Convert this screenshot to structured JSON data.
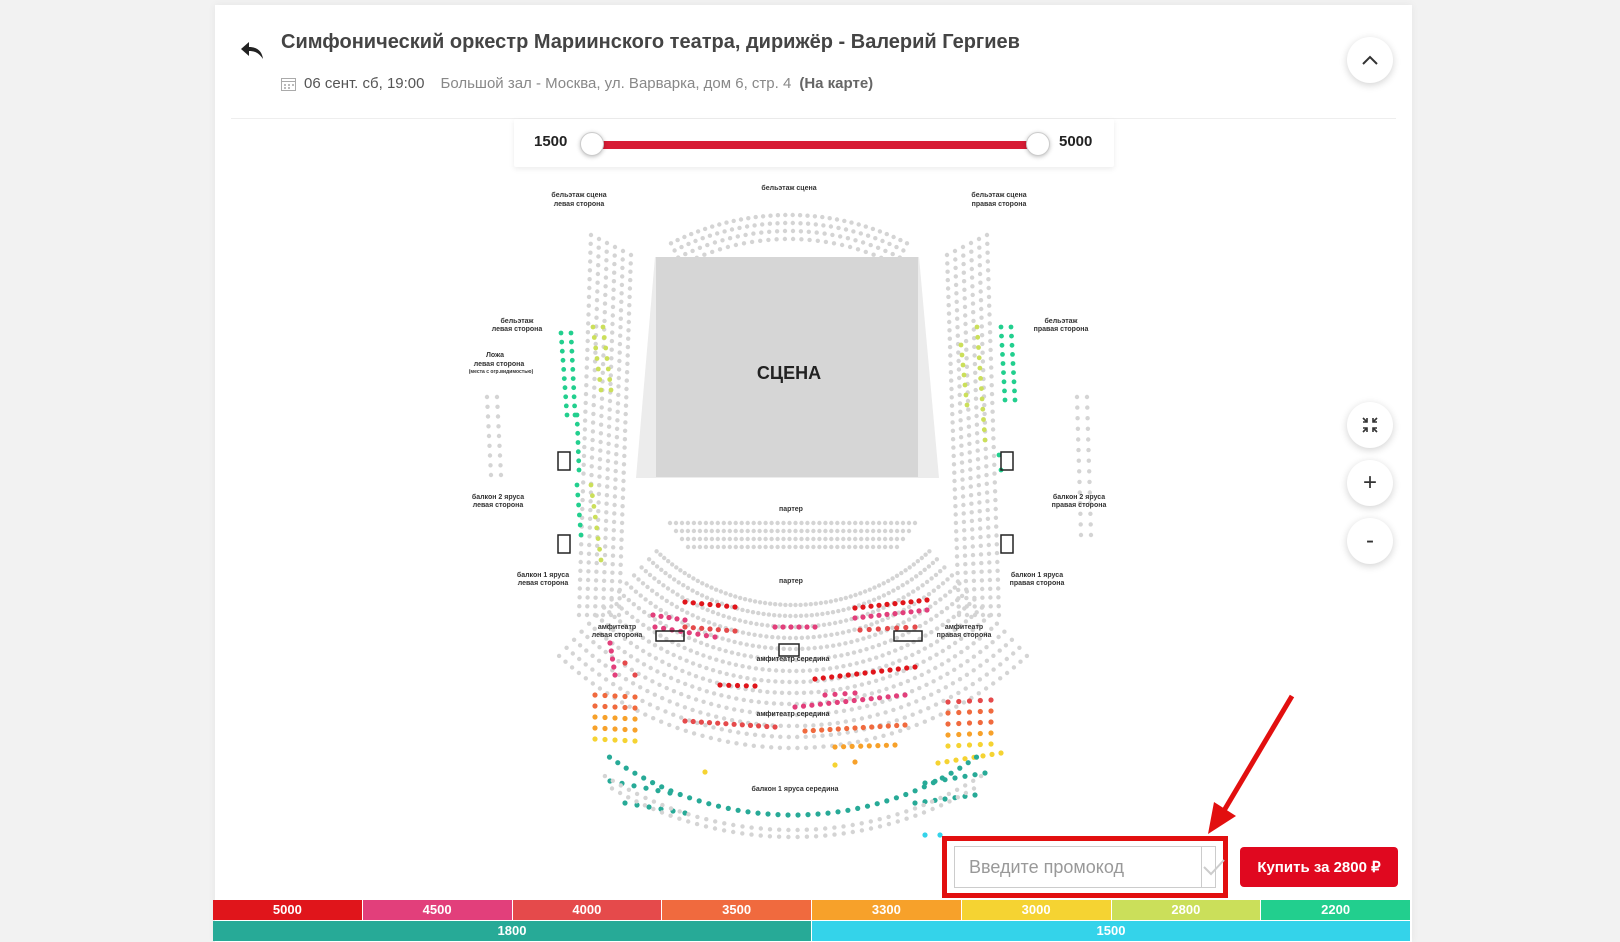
{
  "header": {
    "title": "Симфонический оркестр Мариинского театра, дирижёр - Валерий Гергиев",
    "date": "06 сент. сб, 19:00",
    "venue": "Большой зал - Москва, ул. Варварка, дом 6, стр. 4",
    "map_link": "(На карте)"
  },
  "price_filter": {
    "min_label": "1500",
    "max_label": "5000"
  },
  "hall": {
    "stage_label": "СЦЕНА",
    "sections": {
      "belt_stage": "бельэтаж сцена",
      "belt_stage_left_1": "бельэтаж сцена",
      "belt_stage_left_2": "левая сторона",
      "belt_stage_right_1": "бельэтаж сцена",
      "belt_stage_right_2": "правая сторона",
      "belt_left_1": "бельэтаж",
      "belt_left_2": "левая сторона",
      "belt_right_1": "бельэтаж",
      "belt_right_2": "правая сторона",
      "loge_left_1": "Ложа",
      "loge_left_2": "левая сторона",
      "loge_left_3": "(места с огр.видимостью)",
      "balcony2_left_1": "балкон 2 яруса",
      "balcony2_left_2": "левая сторона",
      "balcony2_right_1": "балкон 2 яруса",
      "balcony2_right_2": "правая сторона",
      "balcony1_left_1": "балкон 1 яруса",
      "balcony1_left_2": "левая сторона",
      "balcony1_right_1": "балкон 1 яруса",
      "balcony1_right_2": "правая сторона",
      "parterre_top": "партер",
      "parterre_bottom": "партер",
      "amphi_left_1": "амфитеатр",
      "amphi_left_2": "левая сторона",
      "amphi_right_1": "амфитеатр",
      "amphi_right_2": "правая сторона",
      "amphi_middle_1": "амфитеатр середина",
      "amphi_middle_2": "амфитеатр середина",
      "balcony1_middle": "балкон 1 яруса середина"
    }
  },
  "promo": {
    "placeholder": "Введите промокод"
  },
  "buy_button": {
    "label": "Купить за 2800 ₽"
  },
  "legend": {
    "row1": [
      {
        "label": "5000",
        "color": "#e0151b"
      },
      {
        "label": "4500",
        "color": "#e23f7b"
      },
      {
        "label": "4000",
        "color": "#e54a4b"
      },
      {
        "label": "3500",
        "color": "#f06a3e"
      },
      {
        "label": "3300",
        "color": "#f7a12a"
      },
      {
        "label": "3000",
        "color": "#f5d332"
      },
      {
        "label": "2800",
        "color": "#cbdf5a"
      },
      {
        "label": "2200",
        "color": "#22cf8e"
      }
    ],
    "row2": [
      {
        "label": "1800",
        "color": "#27aa97"
      },
      {
        "label": "1500",
        "color": "#34d3ea"
      }
    ]
  },
  "icons": {
    "back": "back-arrow-icon",
    "calendar": "calendar-icon",
    "collapse": "chevron-up-icon",
    "fit": "fit-screen-icon",
    "zoom_in": "plus-icon",
    "zoom_out": "minus-icon",
    "confirm": "checkmark-icon"
  },
  "zoom": {
    "in_label": "+",
    "out_label": "-"
  }
}
